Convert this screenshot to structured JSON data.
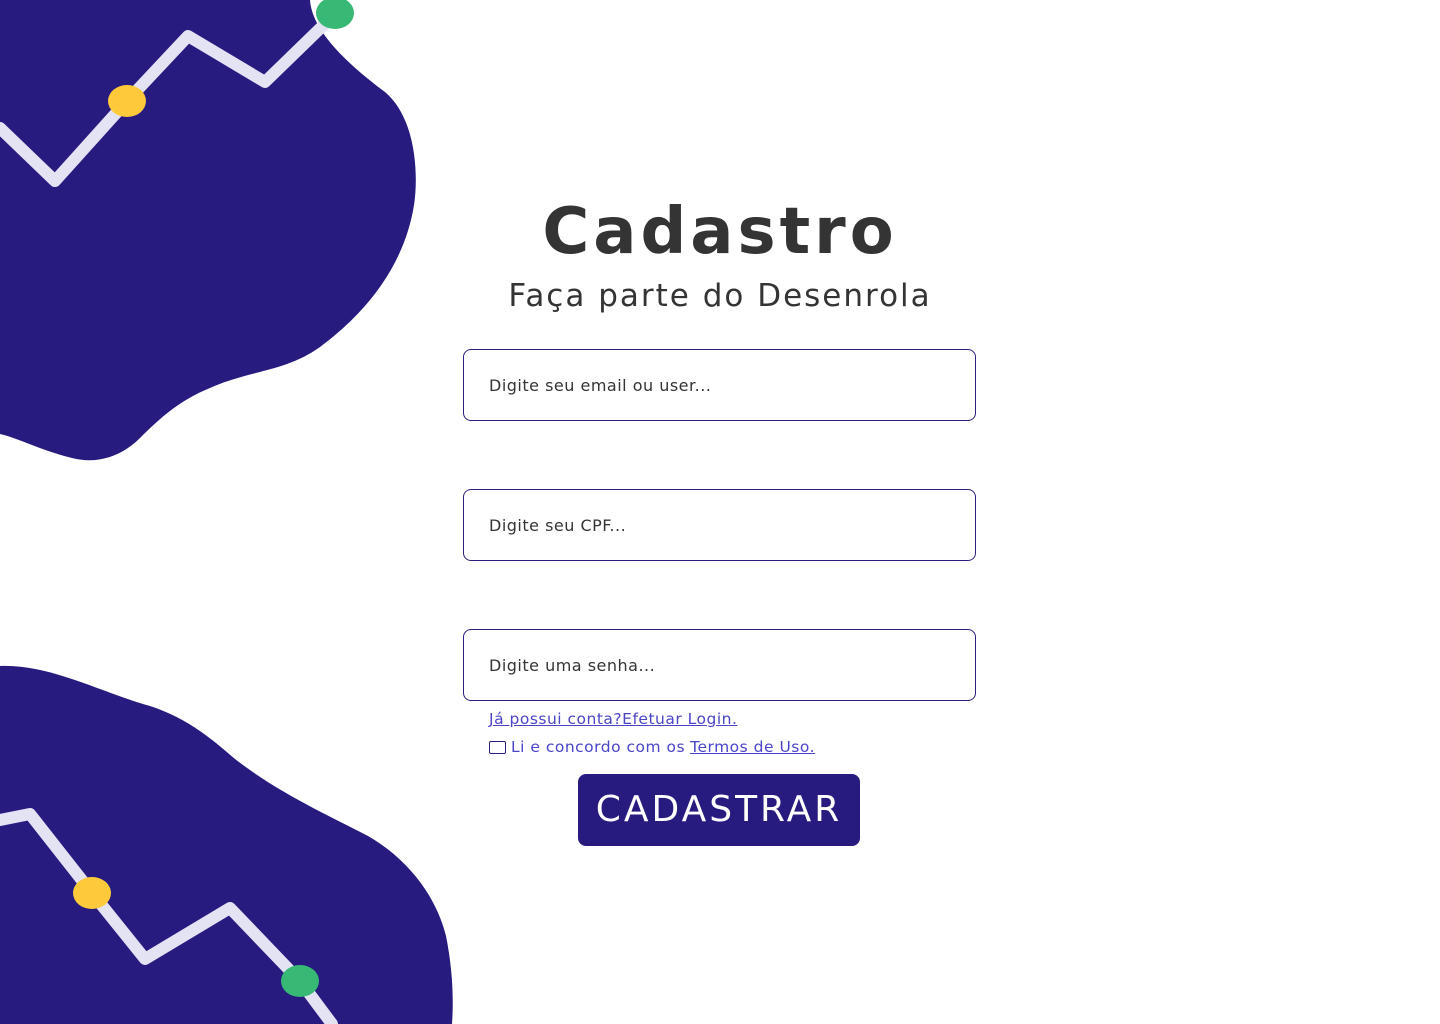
{
  "header": {
    "title": "Cadastro",
    "subtitle": "Faça parte do Desenrola"
  },
  "form": {
    "email_placeholder": "Digite seu email ou user...",
    "cpf_placeholder": "Digite seu CPF...",
    "password_placeholder": "Digite uma senha...",
    "login_link": "Já possui conta?Efetuar Login.",
    "terms_text": "Li e concordo com os",
    "terms_link": "Termos de Uso.",
    "submit_label": "CADASTRAR"
  },
  "colors": {
    "brand": "#281b80",
    "text": "#343434",
    "link": "#4a45c8",
    "dot_yellow": "#ffc93c",
    "dot_green": "#37b874",
    "line": "#e4e3f3"
  }
}
